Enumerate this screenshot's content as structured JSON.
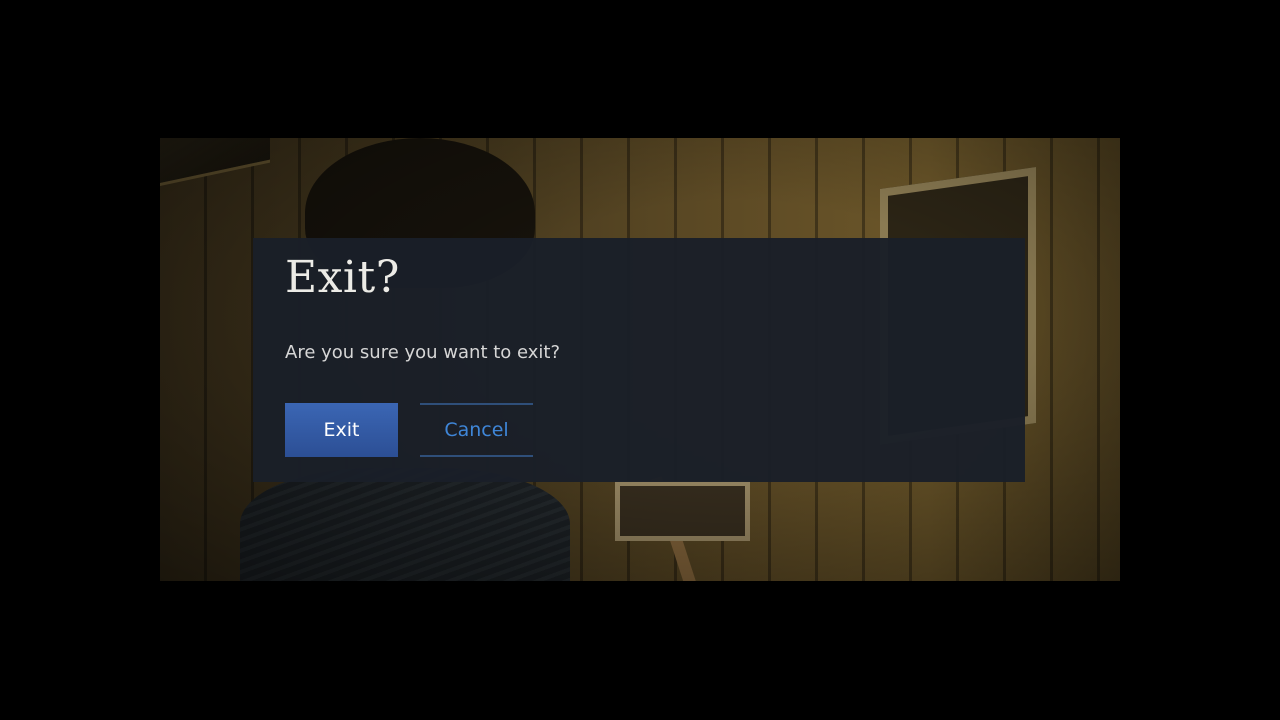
{
  "dialog": {
    "title": "Exit?",
    "message": "Are you sure you want to exit?",
    "primary_label": "Exit",
    "secondary_label": "Cancel"
  },
  "colors": {
    "dialog_background": "#1a1f28",
    "primary_button": "#3b66b4",
    "secondary_text": "#3f86d8"
  }
}
